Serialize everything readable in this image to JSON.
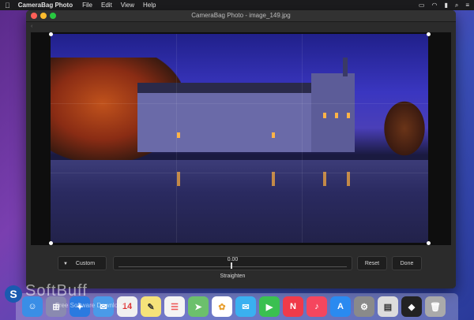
{
  "menubar": {
    "apple_icon": "apple-logo",
    "app_name": "CameraBag Photo",
    "menus": [
      "File",
      "Edit",
      "View",
      "Help"
    ]
  },
  "window": {
    "title": "CameraBag Photo - image_149.jpg"
  },
  "controls": {
    "preset_label": "Custom",
    "slider_value": "0.00",
    "slider_label": "Straighten",
    "reset_label": "Reset",
    "done_label": "Done"
  },
  "watermark": {
    "brand": "SoftBuff",
    "tagline": "Free Software Downloads"
  },
  "dock": {
    "icons": [
      "finder-icon",
      "launchpad-icon",
      "safari-icon",
      "mail-icon",
      "calendar-icon",
      "notes-icon",
      "reminders-icon",
      "maps-icon",
      "photos-icon",
      "messages-icon",
      "facetime-icon",
      "news-icon",
      "music-icon",
      "app-store-icon",
      "system-preferences-icon",
      "preview-icon",
      "camerabag-icon",
      "trash-icon"
    ]
  },
  "colors": {
    "menubar_bg": "#1c1c1e",
    "window_bg": "#2b2b2b",
    "accent_lit_window": "#ffb347"
  }
}
